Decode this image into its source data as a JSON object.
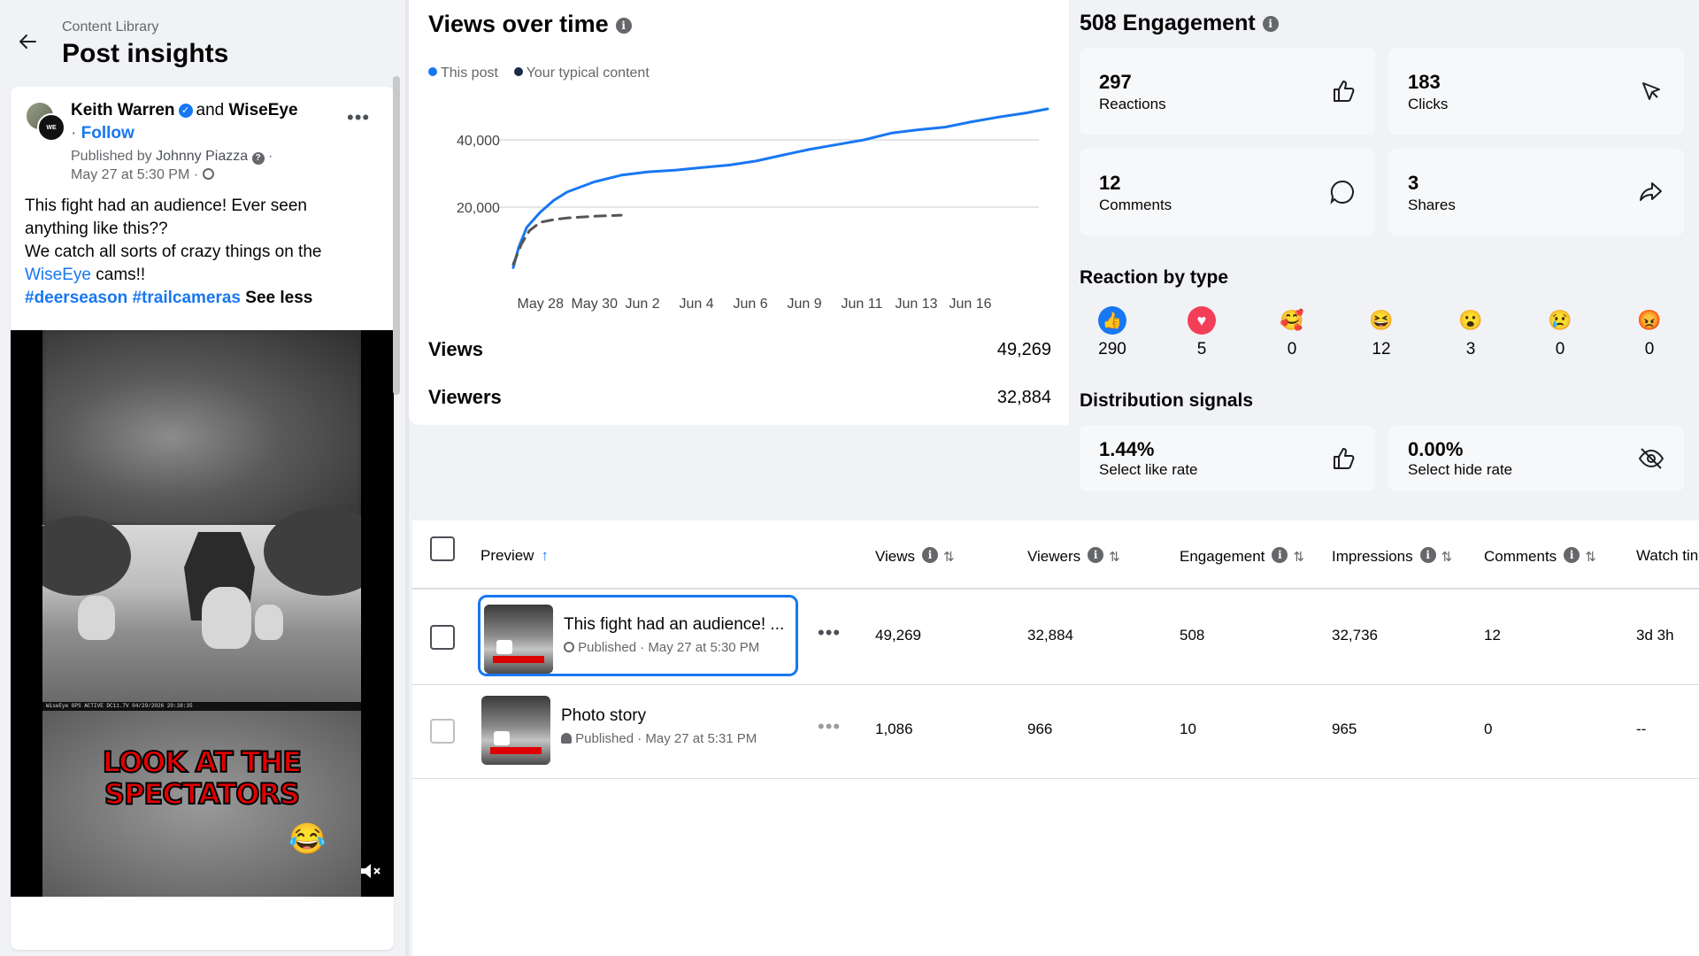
{
  "header": {
    "breadcrumb": "Content Library",
    "title": "Post insights"
  },
  "post": {
    "author": "Keith Warren",
    "and_text": "and",
    "co_author": "WiseEye",
    "follow": "Follow",
    "published_by_label": "Published by",
    "publisher": "Johnny Piazza",
    "date": "May 27 at 5:30 PM ·",
    "text_line1": "This fight had an audience! Ever seen anything like this??",
    "text_line2": "We catch all sorts of crazy things on the",
    "text_link": "WiseEye",
    "text_after_link": "cams!!",
    "hashtag1": "#deerseason",
    "hashtag2": "#trailcameras",
    "see_less": "See less",
    "overlay_text": "LOOK AT THE SPECTATORS",
    "cam_bar_text": "WiseEye  GPS ACTIVE                DC11.7V  04/29/2026 20:38:35"
  },
  "views_chart": {
    "title": "Views over time",
    "legend_this": "This post",
    "legend_typical": "Your typical content",
    "views_label": "Views",
    "views_value": "49,269",
    "viewers_label": "Viewers",
    "viewers_value": "32,884"
  },
  "chart_data": {
    "type": "line",
    "title": "Views over time",
    "x_ticks": [
      "May 28",
      "May 30",
      "Jun 2",
      "Jun 4",
      "Jun 6",
      "Jun 9",
      "Jun 11",
      "Jun 13",
      "Jun 16"
    ],
    "y_ticks": [
      "20,000",
      "40,000"
    ],
    "ylim": [
      0,
      50000
    ],
    "series": [
      {
        "name": "This post",
        "color": "#1877f2",
        "dashed": false,
        "x": [
          0,
          0.2,
          0.5,
          1,
          1.5,
          2,
          3,
          4,
          5,
          6,
          7,
          8,
          9,
          10,
          11,
          12,
          13,
          14,
          15,
          16,
          17,
          18,
          19,
          19.8
        ],
        "y": [
          2000,
          8000,
          14000,
          18500,
          22000,
          24500,
          27500,
          29500,
          30500,
          31000,
          31800,
          32500,
          33700,
          35500,
          37200,
          38600,
          40000,
          42000,
          43000,
          43800,
          45400,
          46800,
          48000,
          49200
        ]
      },
      {
        "name": "Your typical content",
        "color": "#555555",
        "dashed": true,
        "x": [
          0,
          0.3,
          0.6,
          1,
          1.5,
          2,
          3,
          4
        ],
        "y": [
          3000,
          9000,
          13000,
          15500,
          16300,
          16800,
          17300,
          17600
        ]
      }
    ],
    "x_axis_start": "May 27"
  },
  "engagement": {
    "title": "508 Engagement",
    "reactions_num": "297",
    "reactions_label": "Reactions",
    "clicks_num": "183",
    "clicks_label": "Clicks",
    "comments_num": "12",
    "comments_label": "Comments",
    "shares_num": "3",
    "shares_label": "Shares"
  },
  "reactions": {
    "title": "Reaction by type",
    "items": [
      {
        "name": "like",
        "count": "290"
      },
      {
        "name": "love",
        "count": "5"
      },
      {
        "name": "care",
        "count": "0"
      },
      {
        "name": "haha",
        "count": "12"
      },
      {
        "name": "wow",
        "count": "3"
      },
      {
        "name": "sad",
        "count": "0"
      },
      {
        "name": "angry",
        "count": "0"
      }
    ]
  },
  "distribution": {
    "title": "Distribution signals",
    "like_rate": "1.44%",
    "like_label": "Select like rate",
    "hide_rate": "0.00%",
    "hide_label": "Select hide rate"
  },
  "table": {
    "columns": [
      "Preview",
      "Views",
      "Viewers",
      "Engagement",
      "Impressions",
      "Comments",
      "Watch tin"
    ],
    "rows": [
      {
        "title": "This fight had an audience! ...",
        "status": "Published",
        "date": "May 27 at 5:30 PM",
        "views": "49,269",
        "viewers": "32,884",
        "engagement": "508",
        "impressions": "32,736",
        "comments": "12",
        "watch": "3d 3h"
      },
      {
        "title": "Photo story",
        "status": "Published",
        "date": "May 27 at 5:31 PM",
        "views": "1,086",
        "viewers": "966",
        "engagement": "10",
        "impressions": "965",
        "comments": "0",
        "watch": "--"
      }
    ]
  }
}
